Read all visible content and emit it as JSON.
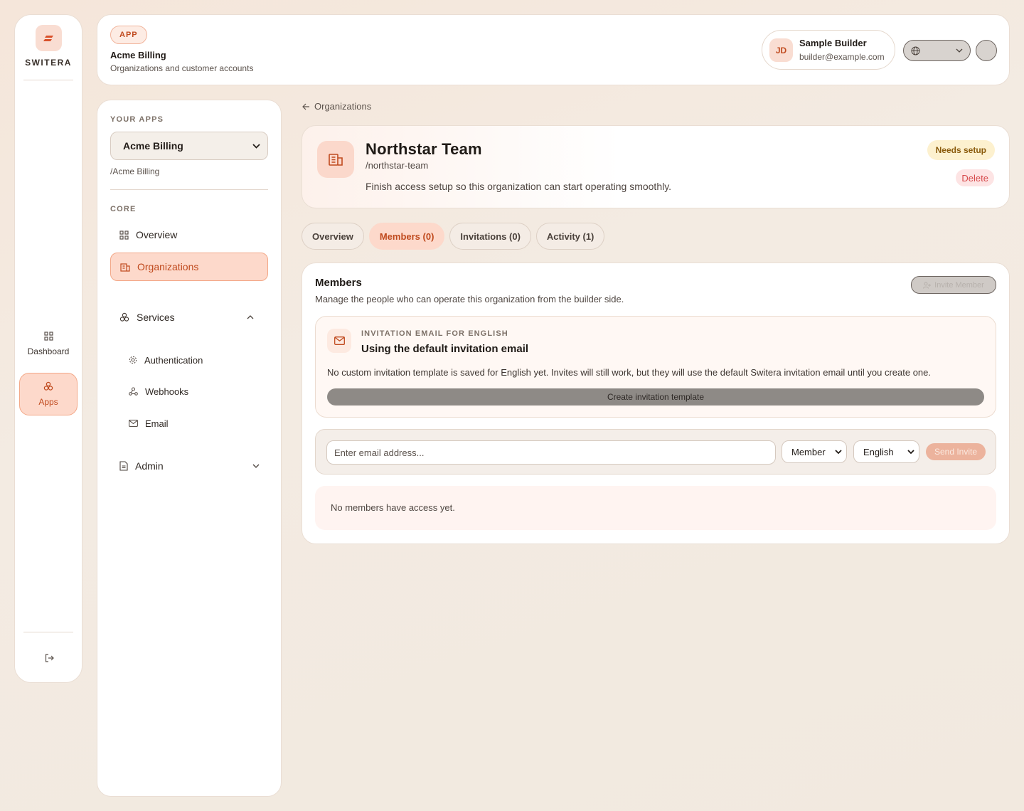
{
  "rail": {
    "brand": "SWITERA",
    "items": [
      {
        "label": "Dashboard",
        "icon": "grid-icon"
      },
      {
        "label": "Apps",
        "icon": "apps-icon"
      }
    ],
    "logout_icon": "logout-icon"
  },
  "topbar": {
    "pill": "APP",
    "app_name": "Acme Billing",
    "app_sub": "Organizations and customer accounts",
    "user": {
      "initials": "JD",
      "name": "Sample Builder",
      "email": "builder@example.com"
    }
  },
  "sidebar": {
    "your_apps_label": "YOUR APPS",
    "selected_app": "Acme Billing",
    "app_path": "/Acme Billing",
    "core_label": "CORE",
    "overview": "Overview",
    "organizations": "Organizations",
    "services": "Services",
    "sub_items": [
      {
        "label": "Authentication",
        "icon": "gear-icon"
      },
      {
        "label": "Webhooks",
        "icon": "webhook-icon"
      },
      {
        "label": "Email",
        "icon": "mail-icon"
      }
    ],
    "admin": "Admin"
  },
  "breadcrumb": {
    "back": "Organizations"
  },
  "org": {
    "name": "Northstar Team",
    "slug": "/northstar-team",
    "description": "Finish access setup so this organization can start operating smoothly.",
    "status": "Needs setup",
    "delete_label": "Delete"
  },
  "tabs": [
    "Overview",
    "Members (0)",
    "Invitations (0)",
    "Activity (1)"
  ],
  "members": {
    "title": "Members",
    "subtitle": "Manage the people who can operate this organization from the builder side.",
    "invite_button": "Invite Member",
    "template": {
      "kicker": "INVITATION EMAIL FOR ENGLISH",
      "title": "Using the default invitation email",
      "description": "No custom invitation template is saved for English yet. Invites will still work, but they will use the default Switera invitation email until you create one.",
      "button": "Create invitation template"
    },
    "invite_form": {
      "email_placeholder": "Enter email address...",
      "role": "Member",
      "language": "English",
      "send": "Send Invite"
    },
    "empty": "No members have access yet."
  },
  "colors": {
    "accent": "#c04a1e",
    "accent_bg": "#fdd9cb",
    "warning_bg": "#fdf1cf",
    "danger": "#d6494b"
  }
}
